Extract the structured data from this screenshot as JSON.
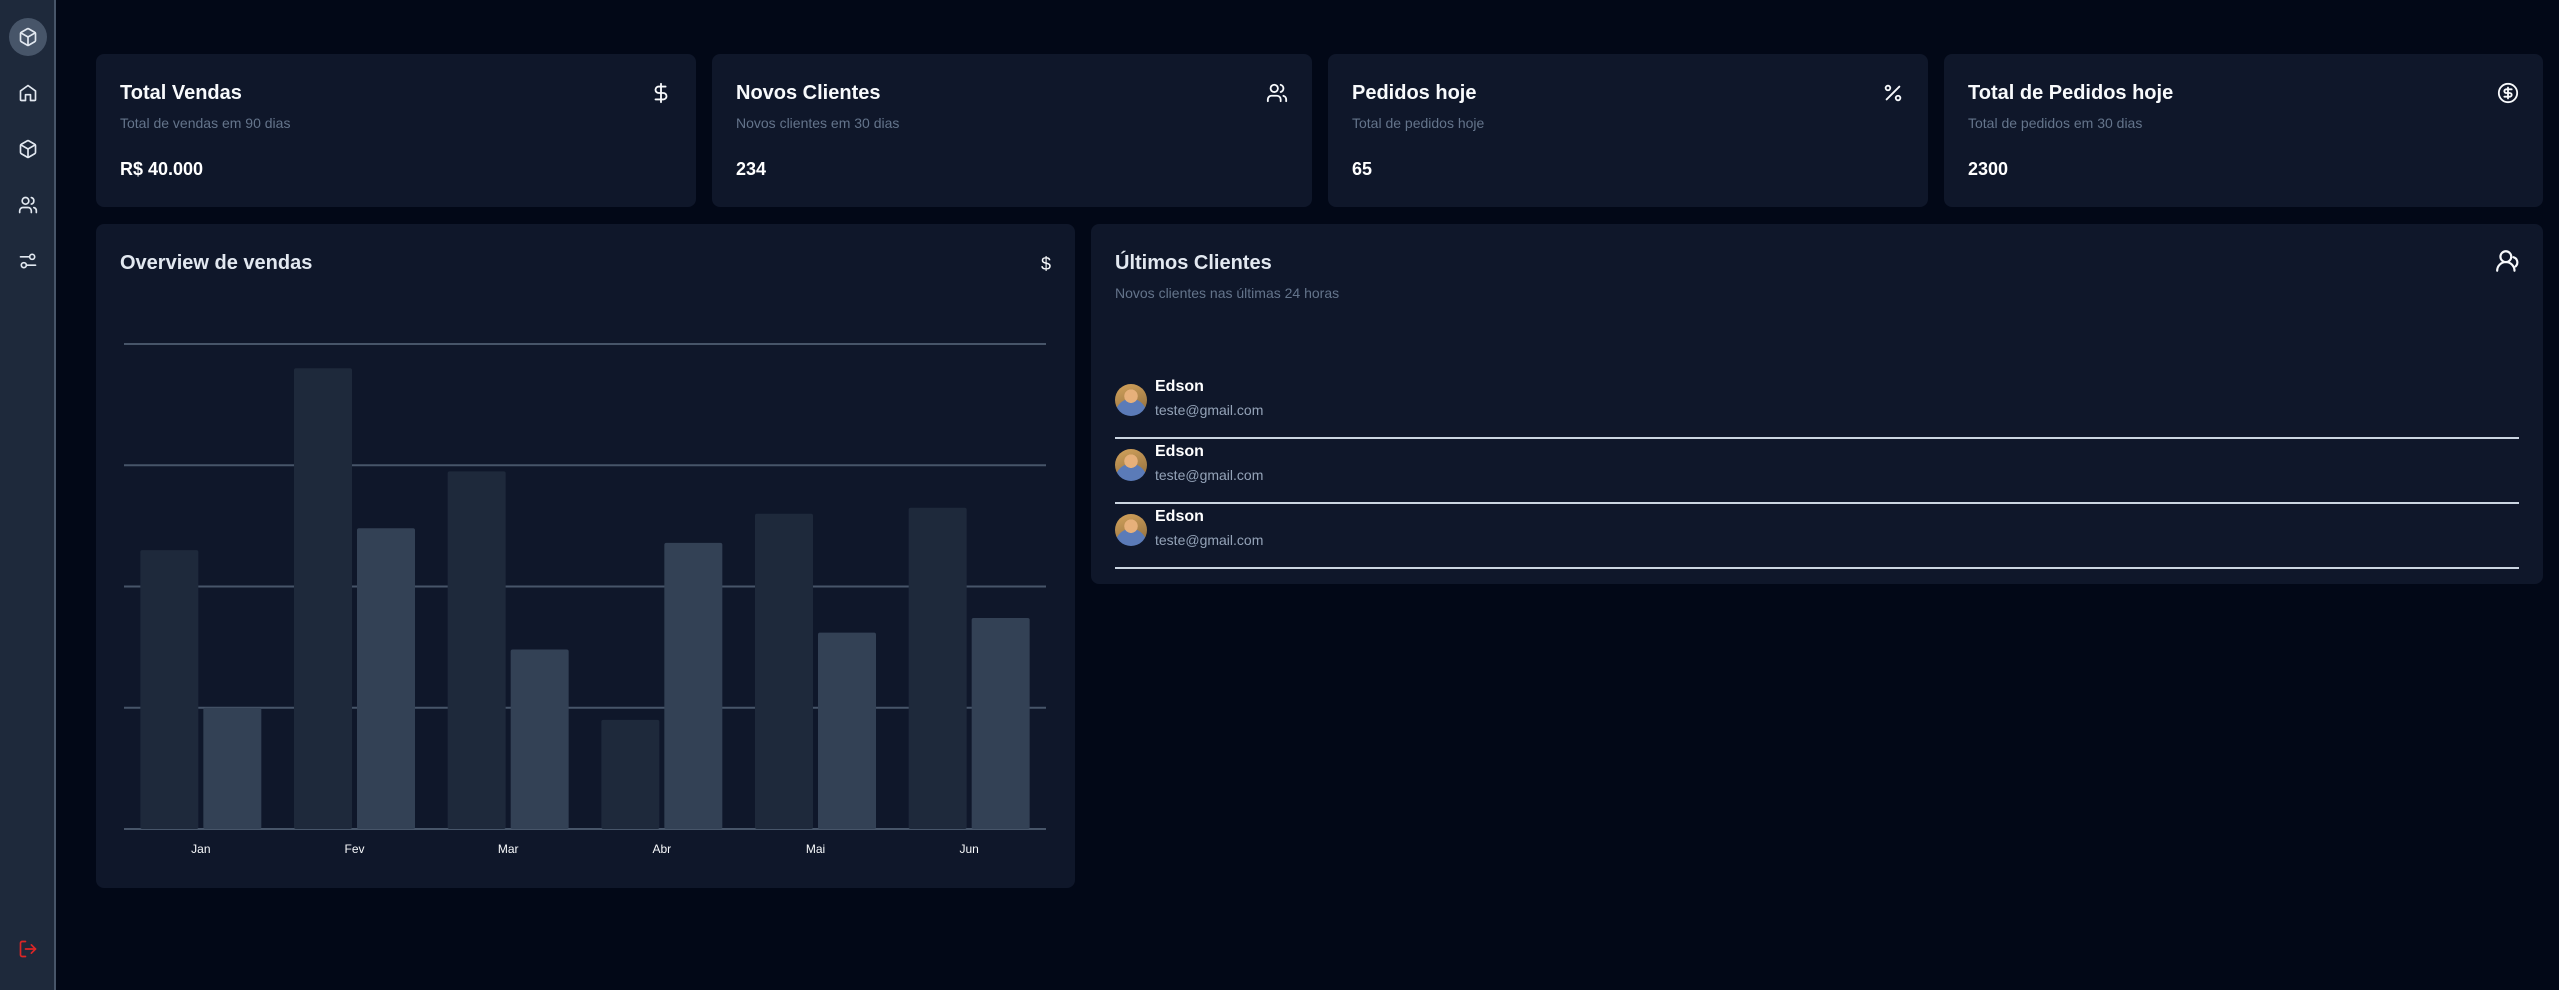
{
  "sidebar": {
    "items": [
      {
        "name": "logo",
        "icon": "box-icon"
      },
      {
        "name": "home",
        "icon": "home-icon"
      },
      {
        "name": "products",
        "icon": "box-icon"
      },
      {
        "name": "customers",
        "icon": "users-icon"
      },
      {
        "name": "settings",
        "icon": "sliders-icon"
      }
    ],
    "logout_icon": "log-out-icon"
  },
  "stats": [
    {
      "title": "Total Vendas",
      "subtitle": "Total de vendas em 90 dias",
      "value": "R$ 40.000",
      "icon": "dollar-icon"
    },
    {
      "title": "Novos Clientes",
      "subtitle": "Novos clientes em 30 dias",
      "value": "234",
      "icon": "users-icon"
    },
    {
      "title": "Pedidos hoje",
      "subtitle": "Total de pedidos hoje",
      "value": "65",
      "icon": "percent-icon"
    },
    {
      "title": "Total de Pedidos hoje",
      "subtitle": "Total de pedidos em 30 dias",
      "value": "2300",
      "icon": "circle-dollar-icon"
    }
  ],
  "overview": {
    "title": "Overview de vendas",
    "icon_glyph": "$"
  },
  "chart_data": {
    "type": "bar",
    "categories": [
      "Jan",
      "Fev",
      "Mar",
      "Abr",
      "Mai",
      "Jun"
    ],
    "series": [
      {
        "values": [
          2300,
          3800,
          2950,
          900,
          2600,
          2650
        ],
        "color": "#1e293b"
      },
      {
        "values": [
          1000,
          2480,
          1480,
          2360,
          1620,
          1740
        ],
        "color": "#334155"
      }
    ],
    "ylim": [
      0,
      4000
    ],
    "gridlines": [
      0,
      1000,
      2000,
      3000,
      4000
    ],
    "grid": true
  },
  "clients": {
    "title": "Últimos Clientes",
    "subtitle": "Novos clientes nas últimas 24 horas",
    "items": [
      {
        "name": "Edson",
        "email": "teste@gmail.com"
      },
      {
        "name": "Edson",
        "email": "teste@gmail.com"
      },
      {
        "name": "Edson",
        "email": "teste@gmail.com"
      }
    ]
  },
  "colors": {
    "background": "#020817",
    "card": "#0f172a",
    "sidebar": "#1e293b",
    "logout": "#dc2626"
  }
}
